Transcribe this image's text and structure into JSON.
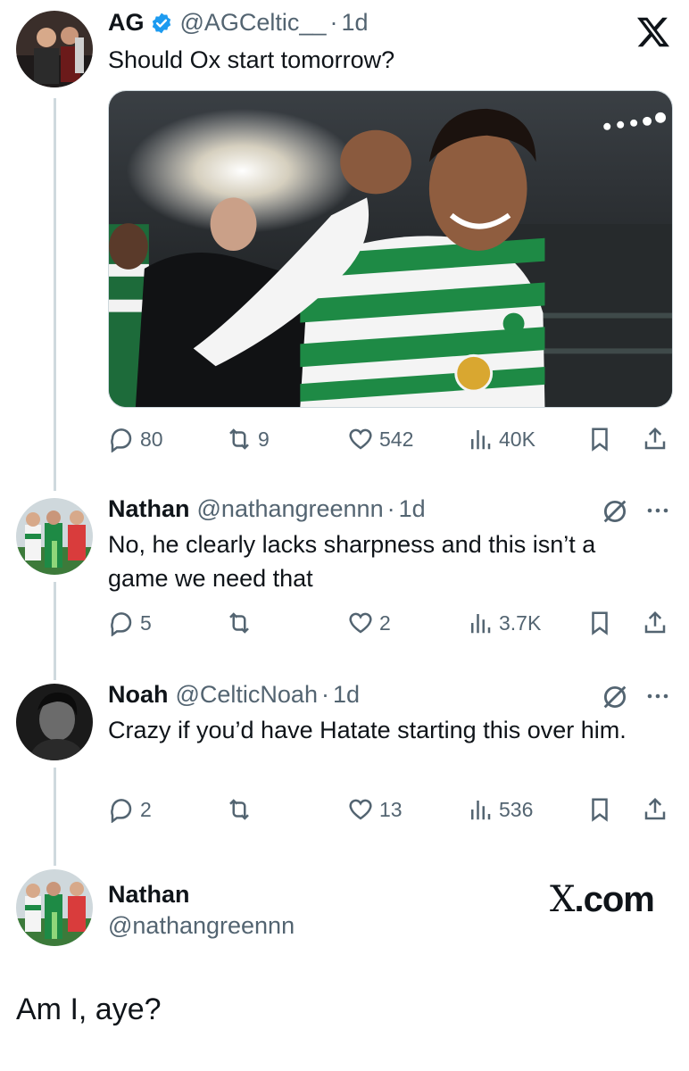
{
  "tweet_main": {
    "name": "AG",
    "handle": "@AGCeltic__",
    "time": "1d",
    "text": "Should Ox start tomorrow?",
    "stats": {
      "replies": "80",
      "reposts": "9",
      "likes": "542",
      "views": "40K"
    }
  },
  "reply_1": {
    "name": "Nathan",
    "handle": "@nathangreennn",
    "time": "1d",
    "text": "No, he clearly lacks sharpness and this isn’t a game we need that",
    "stats": {
      "replies": "5",
      "reposts": "",
      "likes": "2",
      "views": "3.7K"
    }
  },
  "reply_2": {
    "name": "Noah",
    "handle": "@CelticNoah",
    "time": "1d",
    "text": "Crazy if you’d have Hatate starting this over him.",
    "stats": {
      "replies": "2",
      "reposts": "",
      "likes": "13",
      "views": "536"
    }
  },
  "quote_card": {
    "name": "Nathan",
    "handle": "@nathangreennn",
    "brand_prefix": "X",
    "brand_suffix": ".com"
  },
  "final_text": "Am I, aye?",
  "icons": {
    "platform_logo": "x-logo-icon",
    "verified": "verified-badge-icon",
    "reply": "reply-icon",
    "repost": "repost-icon",
    "like": "like-icon",
    "views": "views-icon",
    "bookmark": "bookmark-icon",
    "share": "share-icon",
    "mute": "mute-icon",
    "more": "more-icon"
  },
  "colors": {
    "text": "#0f1419",
    "secondary": "#536471",
    "verified": "#1d9bf0",
    "thread_line": "#cfd9de"
  }
}
